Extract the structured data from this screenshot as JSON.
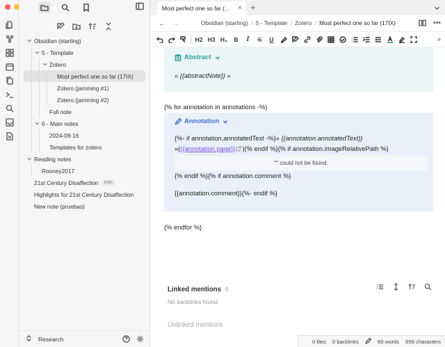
{
  "window": {
    "traffic_colors": [
      "#ff5f57",
      "#febc2e",
      "#28c840"
    ]
  },
  "ribbon": {
    "icons": [
      "files-icon",
      "graph-icon",
      "blocks-icon",
      "calendar-icon",
      "copy-icon",
      "terminal-icon",
      "search-icon",
      "inbox-icon",
      "document-icon"
    ]
  },
  "sidebar": {
    "tree": [
      {
        "label": "Obsidian (starting)",
        "depth": 0,
        "chev": "down"
      },
      {
        "label": "5 - Template",
        "depth": 1,
        "chev": "down"
      },
      {
        "label": "Zotero",
        "depth": 2,
        "chev": "down"
      },
      {
        "label": "Most perfect one so far (17IX)",
        "depth": 3,
        "selected": true
      },
      {
        "label": "Zotero (jamming #1)",
        "depth": 3
      },
      {
        "label": "Zotero (jamming #2)",
        "depth": 3
      },
      {
        "label": "Full note",
        "depth": 2
      },
      {
        "label": "6 - Main notes",
        "depth": 1,
        "chev": "down"
      },
      {
        "label": "2024-09-16",
        "depth": 2
      },
      {
        "label": "Templates for zotero",
        "depth": 2
      },
      {
        "label": "Reading notes",
        "depth": 0,
        "chev": "down"
      },
      {
        "label": "Rooney2017",
        "depth": 1
      },
      {
        "label": "21st Century Disaffection",
        "depth": 0,
        "badge": "PDF"
      },
      {
        "label": "Highlights for 21st Century Disaffection",
        "depth": 0
      },
      {
        "label": "New note (pruebas)",
        "depth": 0
      }
    ],
    "vault_name": "Research"
  },
  "tabs": {
    "active_title": "Most perfect one so far (...",
    "close": "×",
    "new": "+"
  },
  "nav": {
    "back": "←",
    "forward": "→",
    "breadcrumb": [
      "Obsidian (starting)",
      "5 - Template",
      "Zotero",
      "Most perfect one so far (17IX)"
    ],
    "sep": "/"
  },
  "toolbar": {
    "h2": "H2",
    "h3": "H3",
    "h4": "H₄",
    "bold": "B",
    "italic": "I",
    "strike": "S",
    "underline": "U",
    "more": "»"
  },
  "editor": {
    "callout1_title": "Abstract",
    "abstract_line": "« {{abstractNote}} »",
    "for_line": "{% for annotation in annotations -%}",
    "callout2_title": "Annotation",
    "ann_line1_a": "{%- if annotation.annotatedText -%}« ",
    "ann_line1_b": "{{annotation.annotatedText}}",
    "ann_line2_a": "»(",
    "ann_line2_link": "{{annotation.page}}",
    "ann_line2_b": "){% endif %}{% if annotation.imageRelativePath %}",
    "not_found": "\"\" could not be found.",
    "ann_line3": "{% endif %}{% if annotation.comment %}",
    "ann_line4": "{{annotation.comment}}{%- endif %}",
    "endfor": "{% endfor %}"
  },
  "backlinks": {
    "linked_title": "Linked mentions",
    "linked_count": "0",
    "none": "No backlinks found.",
    "unlinked_title": "Unlinked mentions"
  },
  "status": {
    "files": "0 files",
    "backlinks": "0 backlinks",
    "words": "60 words",
    "chars": "656 characters"
  }
}
